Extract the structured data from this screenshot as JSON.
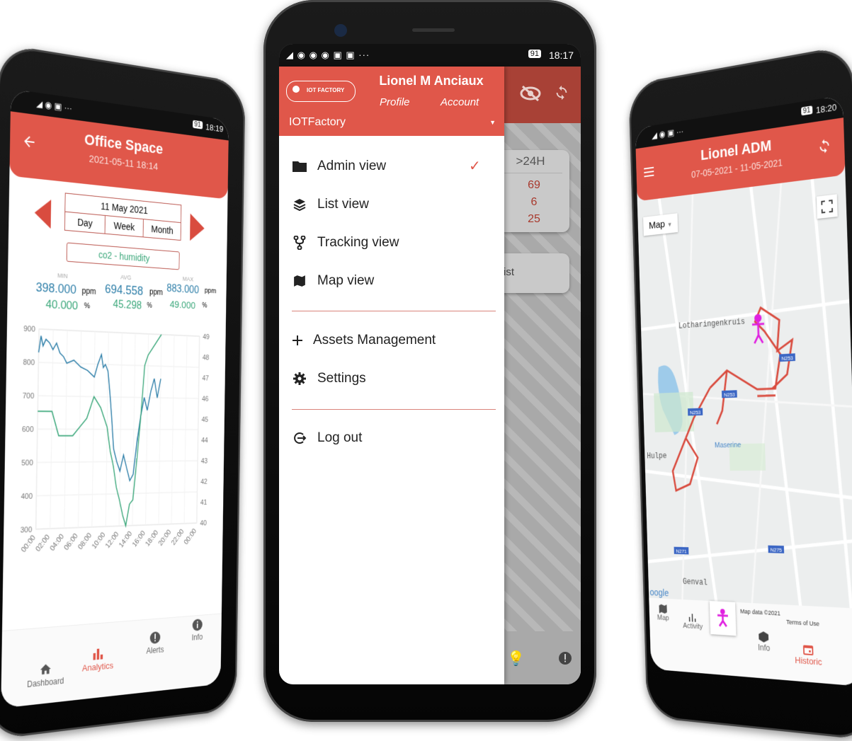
{
  "center": {
    "status_left": "◢ ◉ ◉ ◉ ▣ ▣ ···",
    "status_time": "18:17",
    "status_battery": "91",
    "user_name": "Lionel M Anciaux",
    "logo_text": "IOT FACTORY",
    "profile_label": "Profile",
    "account_label": "Account",
    "org_selected": "IOTFactory",
    "menu": {
      "admin_view": "Admin view",
      "list_view": "List view",
      "tracking_view": "Tracking view",
      "map_view": "Map view",
      "assets_management": "Assets Management",
      "settings": "Settings",
      "log_out": "Log out"
    },
    "bg_tab_label": ">24H",
    "bg_counts": [
      "69",
      "6",
      "25"
    ],
    "bg_list_label": "s list"
  },
  "left": {
    "status_time": "18:19",
    "status_battery": "91",
    "title": "Office Space",
    "datetime": "2021-05-11 18:14",
    "date_label": "11 May 2021",
    "periods": [
      "Day",
      "Week",
      "Month"
    ],
    "sensor": "co2 - humidity",
    "stats": {
      "min_label": "MIN",
      "avg_label": "AVG",
      "max_label": "MAX",
      "co2_min": "398.000",
      "co2_avg": "694.558",
      "co2_max": "883.000",
      "co2_unit": "ppm",
      "hum_min": "40.000",
      "hum_avg": "45.298",
      "hum_max": "49.000",
      "hum_unit": "%"
    },
    "nav": {
      "dashboard": "Dashboard",
      "analytics": "Analytics",
      "alerts": "Alerts",
      "info": "Info"
    },
    "colors": {
      "co2": "#2d7ea8",
      "humidity": "#3aa77a",
      "accent": "#e0574a"
    }
  },
  "right": {
    "status_time": "18:20",
    "status_battery": "91",
    "title": "Lionel ADM",
    "date_range": "07-05-2021 - 11-05-2021",
    "map_type": "Map",
    "places": {
      "lotharingenkruis": "Lotharingenkruis",
      "maserine": "Maserine",
      "hulpe": "Hulpe",
      "genval": "Genval"
    },
    "roads": [
      "N253",
      "N253",
      "N253",
      "N271",
      "N275"
    ],
    "google": "oogle",
    "map_data": "Map data ©2021",
    "terms": "Terms of Use",
    "nav": {
      "map": "Map",
      "activity": "Activity",
      "info": "Info",
      "historic": "Historic"
    }
  },
  "chart_data": {
    "type": "line",
    "x_ticks": [
      "00:00",
      "02:00",
      "04:00",
      "06:00",
      "08:00",
      "10:00",
      "12:00",
      "14:00",
      "16:00",
      "18:00",
      "20:00",
      "22:00",
      "00:00"
    ],
    "y_left_ticks": [
      "900",
      "800",
      "700",
      "600",
      "500",
      "400",
      "300"
    ],
    "y_right_ticks": [
      "49",
      "48",
      "47",
      "46",
      "45",
      "44",
      "43",
      "42",
      "41",
      "40"
    ],
    "ylim_left": [
      300,
      900
    ],
    "ylim_right": [
      40,
      49
    ],
    "series": [
      {
        "name": "co2",
        "axis": "left",
        "x": [
          0,
          0.3,
          0.6,
          1,
          1.5,
          2,
          2.5,
          3,
          3.5,
          4,
          5,
          6,
          7,
          7.5,
          8,
          8.5,
          9,
          9.3,
          9.6,
          10,
          10.3,
          10.6,
          11,
          11.5,
          12,
          12.5,
          13,
          13.5,
          14,
          14.5,
          15,
          15.5,
          16,
          16.5,
          17,
          17.5,
          18
        ],
        "values": [
          830,
          880,
          850,
          870,
          860,
          840,
          860,
          830,
          820,
          800,
          810,
          790,
          780,
          770,
          760,
          800,
          830,
          790,
          800,
          780,
          720,
          650,
          540,
          500,
          470,
          520,
          480,
          440,
          460,
          560,
          640,
          700,
          660,
          720,
          760,
          700,
          760
        ]
      },
      {
        "name": "humidity",
        "axis": "right",
        "x": [
          0,
          1,
          2,
          3,
          4,
          5,
          6,
          7,
          8,
          9,
          10,
          10.5,
          11,
          11.5,
          12,
          12.5,
          13,
          13.5,
          14,
          14.5,
          15,
          15.5,
          16,
          17,
          18
        ],
        "values": [
          45.3,
          45.3,
          45.3,
          44.2,
          44.2,
          44.2,
          44.6,
          45.0,
          46.0,
          45.5,
          44.6,
          43.5,
          42.8,
          41.8,
          41.2,
          40.5,
          40.0,
          41.0,
          41.2,
          43.0,
          45.0,
          47.5,
          48.0,
          48.5,
          49.0
        ]
      }
    ]
  }
}
